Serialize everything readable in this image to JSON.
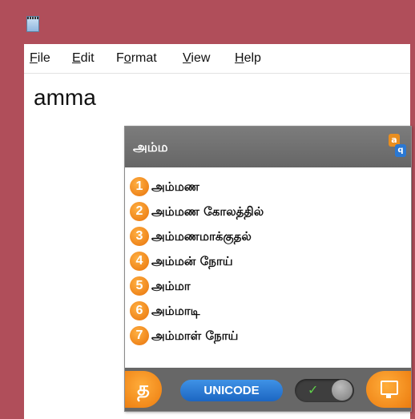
{
  "window": {
    "menu": [
      {
        "label": "File",
        "mnemonic": "F",
        "rest": "ile"
      },
      {
        "label": "Edit",
        "mnemonic": "E",
        "rest": "dit"
      },
      {
        "label": "Format",
        "mnemonic": "o",
        "pre": "F",
        "rest": "rmat"
      },
      {
        "label": "View",
        "mnemonic": "V",
        "rest": "iew"
      },
      {
        "label": "Help",
        "mnemonic": "H",
        "rest": "elp"
      }
    ],
    "editor_text": "amma"
  },
  "ime": {
    "composition": "அம்ம",
    "logo_a": "a",
    "logo_b": "q",
    "candidates": [
      {
        "num": "1",
        "text": "அம்மண"
      },
      {
        "num": "2",
        "text": "அம்மண கோலத்தில்"
      },
      {
        "num": "3",
        "text": "அம்மணமாக்குதல்"
      },
      {
        "num": "4",
        "text": "அம்மன் நோய்"
      },
      {
        "num": "5",
        "text": "அம்மா"
      },
      {
        "num": "6",
        "text": "அம்மாடி"
      },
      {
        "num": "7",
        "text": "அம்மாள் நோய்"
      }
    ],
    "footer": {
      "language_button": "த",
      "encoding_button": "UNICODE",
      "toggle_state": "on",
      "toggle_check": "✓"
    },
    "colors": {
      "accent_orange": "#ec7b0e",
      "unicode_blue": "#1c66c2",
      "header_gray": "#6f6f6f",
      "window_frame": "#b04e5a"
    }
  }
}
